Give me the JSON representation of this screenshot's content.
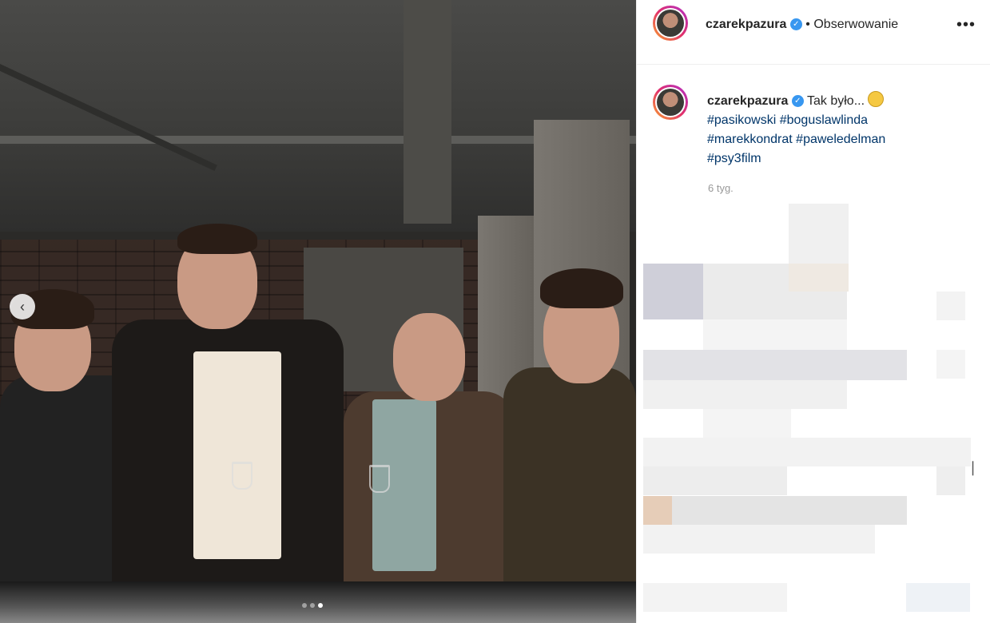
{
  "post": {
    "username": "czarekpazura",
    "verified_icon": "verified-badge-icon",
    "follow_separator": "•",
    "follow_label": "Obserwowanie",
    "more_label": "•••",
    "caption_text": "Tak było...",
    "caption_emoji": "flushed-face-emoji",
    "hashtags": [
      "#pasikowski",
      "#boguslawlinda",
      "#marekkondrat",
      "#paweledelman",
      "#psy3film"
    ],
    "time_ago": "6 tyg."
  },
  "carousel": {
    "prev_icon": "chevron-left-icon",
    "prev_label": "‹",
    "dots_count": 3,
    "active_dot": 3
  },
  "colors": {
    "verified": "#3897f0",
    "hashtag": "#003569",
    "text": "#262626",
    "muted": "#999999"
  }
}
